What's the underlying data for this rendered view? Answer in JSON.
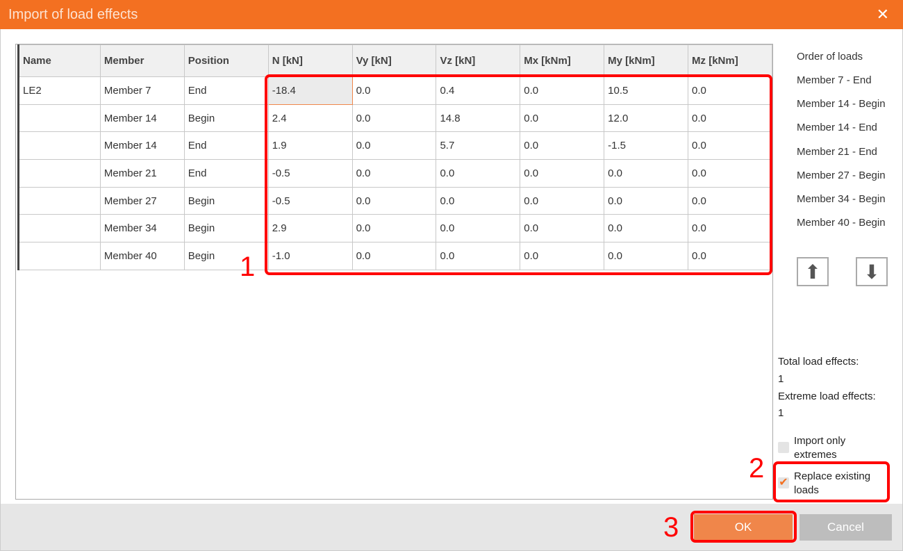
{
  "title": "Import of load effects",
  "columns": [
    "Name",
    "Member",
    "Position",
    "N [kN]",
    "Vy [kN]",
    "Vz [kN]",
    "Mx [kNm]",
    "My [kNm]",
    "Mz [kNm]"
  ],
  "rows": [
    [
      "LE2",
      "Member 7",
      "End",
      "-18.4",
      "0.0",
      "0.4",
      "0.0",
      "10.5",
      "0.0"
    ],
    [
      "",
      "Member 14",
      "Begin",
      "2.4",
      "0.0",
      "14.8",
      "0.0",
      "12.0",
      "0.0"
    ],
    [
      "",
      "Member 14",
      "End",
      "1.9",
      "0.0",
      "5.7",
      "0.0",
      "-1.5",
      "0.0"
    ],
    [
      "",
      "Member 21",
      "End",
      "-0.5",
      "0.0",
      "0.0",
      "0.0",
      "0.0",
      "0.0"
    ],
    [
      "",
      "Member 27",
      "Begin",
      "-0.5",
      "0.0",
      "0.0",
      "0.0",
      "0.0",
      "0.0"
    ],
    [
      "",
      "Member 34",
      "Begin",
      "2.9",
      "0.0",
      "0.0",
      "0.0",
      "0.0",
      "0.0"
    ],
    [
      "",
      "Member 40",
      "Begin",
      "-1.0",
      "0.0",
      "0.0",
      "0.0",
      "0.0",
      "0.0"
    ]
  ],
  "order": {
    "title": "Order of loads",
    "items": [
      "Member 7 - End",
      "Member 14 - Begin",
      "Member 14 - End",
      "Member 21 - End",
      "Member 27 - Begin",
      "Member 34 - Begin",
      "Member 40 - Begin"
    ]
  },
  "stats": {
    "total_label": "Total load effects:",
    "total": "1",
    "extreme_label": "Extreme load effects:",
    "extreme": "1"
  },
  "options": {
    "import_extremes": {
      "label": "Import only extremes",
      "checked": false
    },
    "replace": {
      "label": "Replace existing loads",
      "checked": true
    }
  },
  "buttons": {
    "ok": "OK",
    "cancel": "Cancel"
  },
  "annotations": [
    "1",
    "2",
    "3"
  ],
  "colors": {
    "accent": "#f37021",
    "ok": "#f0864a",
    "annotation": "#ff0000"
  }
}
